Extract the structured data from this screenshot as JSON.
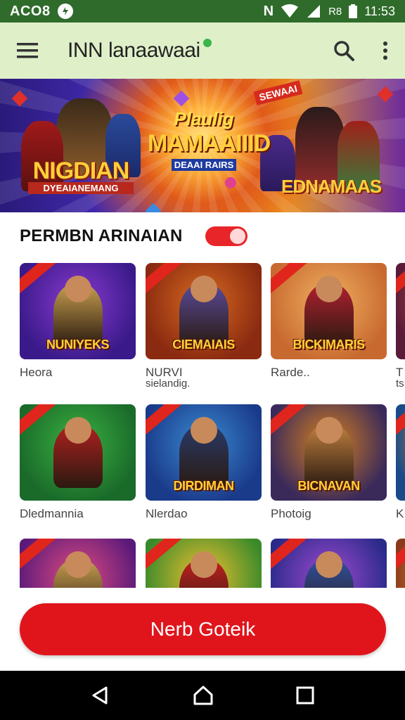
{
  "status_bar": {
    "carrier": "ACO8",
    "badge_icon": "n-notification-icon",
    "indicators": "ᴺ ▼ ◢ R8",
    "time": "11:53"
  },
  "app_bar": {
    "title": "INN lanaawaai",
    "menu_icon": "hamburger-menu-icon",
    "search_icon": "search-icon",
    "more_icon": "more-vertical-icon"
  },
  "banner": {
    "left_logo": "NIGDIAN",
    "left_logo_sub": "DYEAIANEMANG",
    "center_line1": "Plaulig",
    "center_line2": "MAMAAIIID",
    "center_sub": "DEAAI RAIRS",
    "right_logo": "EDNAMAAS",
    "tag": "SEWAAI"
  },
  "section": {
    "title": "PERMBN ARINAIAN",
    "toggle_on": true
  },
  "games": [
    {
      "title": "Heora",
      "subtitle": "",
      "thumb_label": "NUNIYEKS",
      "bg": [
        "#3a1a8a",
        "#8a3ad0"
      ],
      "accent": "#c8a050"
    },
    {
      "title": "NURVI",
      "subtitle": "sielandig.",
      "thumb_label": "CIEMAIAIS",
      "bg": [
        "#8a2a10",
        "#d86a20"
      ],
      "accent": "#5a4a9a"
    },
    {
      "title": "Rarde..",
      "subtitle": "",
      "thumb_label": "BICKIMARIS",
      "bg": [
        "#c86a30",
        "#f0b060"
      ],
      "accent": "#b02030"
    },
    {
      "title": "T",
      "subtitle": "ts",
      "thumb_label": "",
      "bg": [
        "#5a1a3a",
        "#d06030"
      ],
      "accent": "#a04020"
    },
    {
      "title": "Dledmannia",
      "subtitle": "",
      "thumb_label": "",
      "bg": [
        "#1a6a2a",
        "#3ab040"
      ],
      "accent": "#b02020"
    },
    {
      "title": "Nlerdao",
      "subtitle": "",
      "thumb_label": "DIRDIMAN",
      "bg": [
        "#1a3a8a",
        "#3a8ad0"
      ],
      "accent": "#2a3a6a"
    },
    {
      "title": "Photoig",
      "subtitle": "",
      "thumb_label": "BICNAVAN",
      "bg": [
        "#3a2a5a",
        "#d8801e"
      ],
      "accent": "#c08040"
    },
    {
      "title": "K",
      "subtitle": "",
      "thumb_label": "",
      "bg": [
        "#1a4a8a",
        "#f0a020"
      ],
      "accent": "#6a3a2a"
    },
    {
      "title": "",
      "subtitle": "",
      "thumb_label": "",
      "bg": [
        "#5a1a7a",
        "#e04a80"
      ],
      "accent": "#c8a050"
    },
    {
      "title": "",
      "subtitle": "",
      "thumb_label": "",
      "bg": [
        "#3a8a2a",
        "#f0c030"
      ],
      "accent": "#c02020"
    },
    {
      "title": "",
      "subtitle": "",
      "thumb_label": "",
      "bg": [
        "#2a2a8a",
        "#a04ad0"
      ],
      "accent": "#3050a0"
    },
    {
      "title": "",
      "subtitle": "",
      "thumb_label": "",
      "bg": [
        "#8a3a1a",
        "#f0a040"
      ],
      "accent": "#6a3a2a"
    }
  ],
  "cta": {
    "label": "Nerb Goteik"
  },
  "nav_bar": {
    "back_icon": "back-triangle-icon",
    "home_icon": "home-icon",
    "recents_icon": "recents-square-icon"
  }
}
